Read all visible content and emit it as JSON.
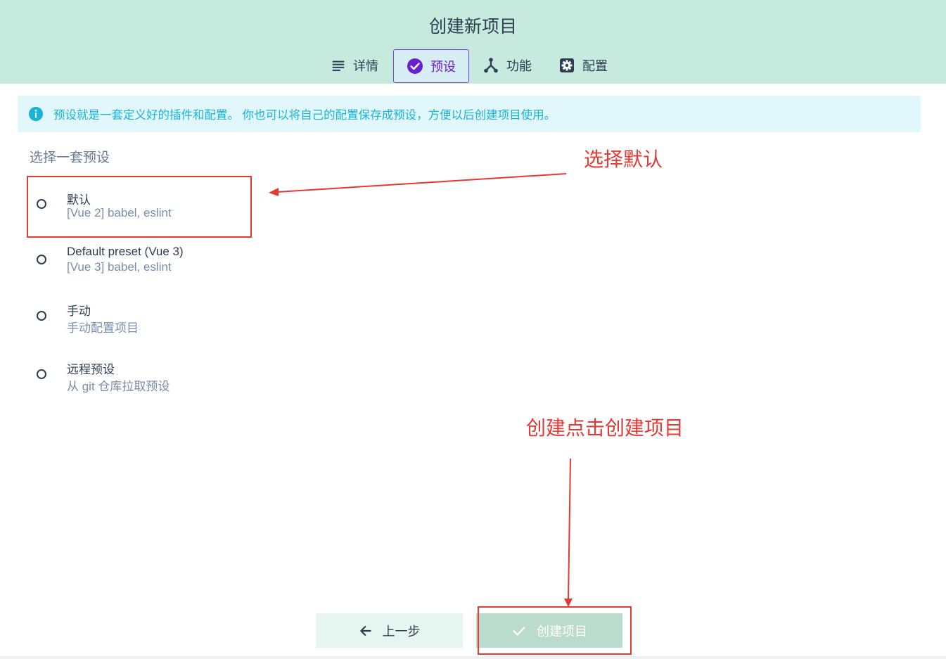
{
  "header": {
    "title": "创建新项目",
    "tabs": [
      {
        "label": "详情",
        "icon": "list-icon",
        "active": false
      },
      {
        "label": "预设",
        "icon": "check-circle-icon",
        "active": true
      },
      {
        "label": "功能",
        "icon": "fork-icon",
        "active": false
      },
      {
        "label": "配置",
        "icon": "gear-icon",
        "active": false
      }
    ]
  },
  "info_banner": {
    "text": "预设就是一套定义好的插件和配置。 你也可以将自己的配置保存成预设，方便以后创建项目使用。",
    "icon": "info-icon"
  },
  "presets": {
    "label": "选择一套预设",
    "options": [
      {
        "name": "默认",
        "description": "[Vue 2] babel, eslint"
      },
      {
        "name": "Default preset (Vue 3)",
        "description": "[Vue 3] babel, eslint"
      },
      {
        "name": "手动",
        "description": "手动配置项目"
      },
      {
        "name": "远程预设",
        "description": "从 git 仓库拉取预设"
      }
    ]
  },
  "footer": {
    "prev_label": "上一步",
    "create_label": "创建项目"
  },
  "annotations": {
    "select_default": "选择默认",
    "click_create": "创建点击创建项目"
  },
  "colors": {
    "header_bg": "#c6eadd",
    "accent": "#6a1fd1",
    "info_text": "#19b3d6",
    "annotation": "#e53935",
    "create_button": "#b9dccd"
  }
}
